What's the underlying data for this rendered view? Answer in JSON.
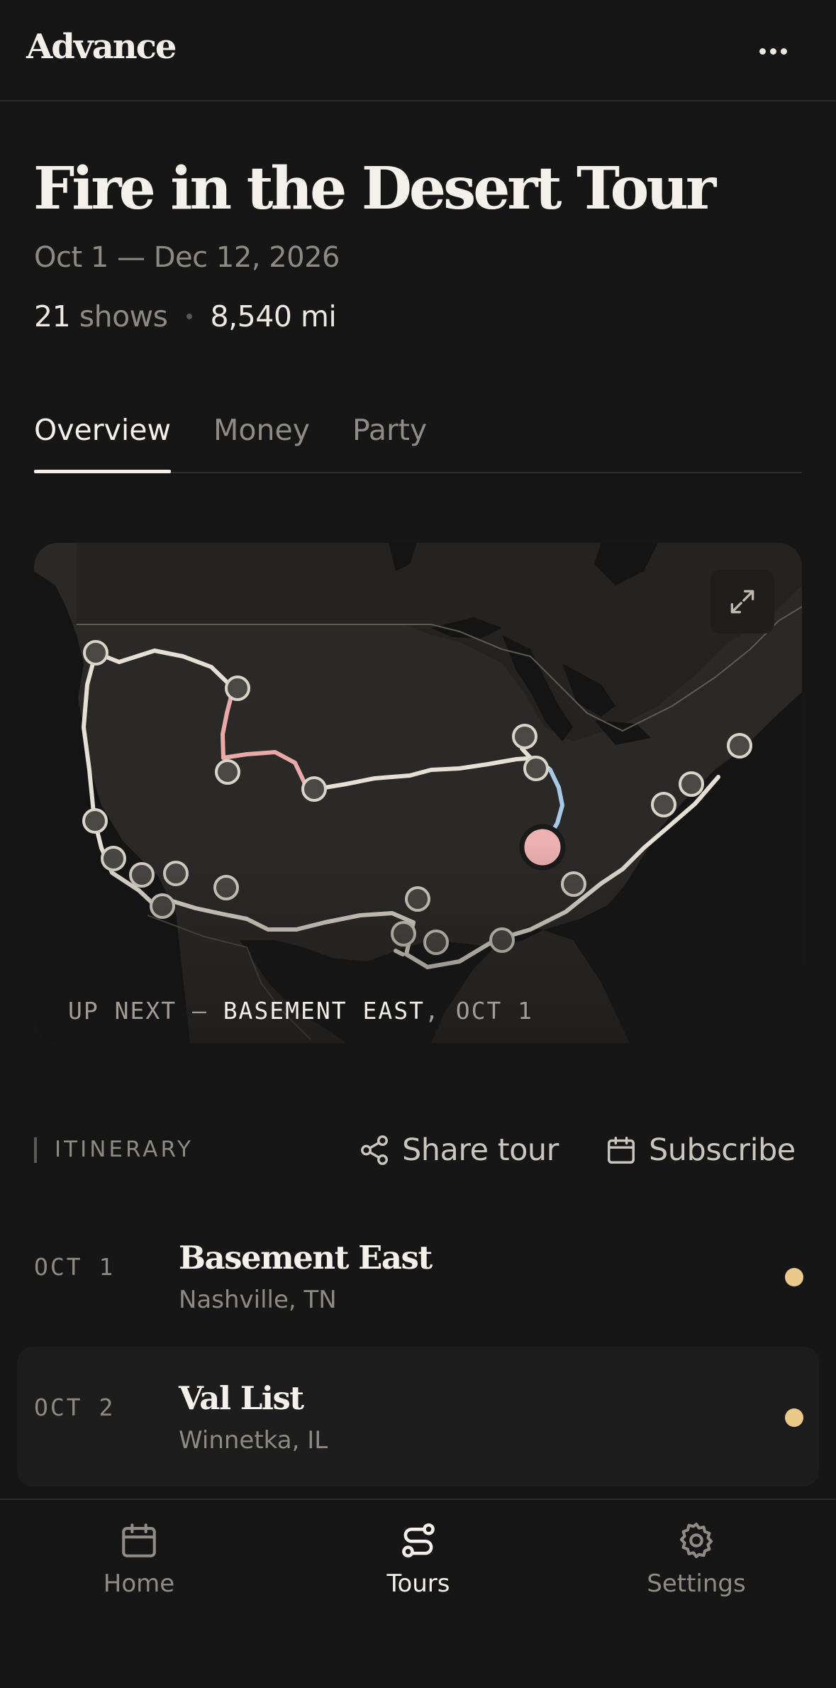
{
  "app": {
    "brand": "Advance"
  },
  "header": {
    "title": "Fire in the Desert Tour",
    "dates": "Oct 1 — Dec 12, 2026",
    "shows_count": "21",
    "shows_word": "shows",
    "distance": "8,540 mi"
  },
  "tabs": [
    {
      "label": "Overview",
      "active": true
    },
    {
      "label": "Money",
      "active": false
    },
    {
      "label": "Party",
      "active": false
    }
  ],
  "map": {
    "up_next_prefix": "UP NEXT — ",
    "up_next_venue": "BASEMENT EAST",
    "up_next_date": ", OCT 1",
    "route_colors": {
      "main": "#E5E0D6",
      "highlight_pink": "#E9A9A9",
      "highlight_blue": "#A9C8E6",
      "current_stop": "#EDB1B1"
    }
  },
  "itinerary": {
    "label": "ITINERARY",
    "share_label": "Share tour",
    "subscribe_label": "Subscribe",
    "rows": [
      {
        "date": "OCT 1",
        "venue": "Basement East",
        "city": "Nashville, TN",
        "status_color": "#EAC98A"
      },
      {
        "date": "OCT 2",
        "venue": "Val List",
        "city": "Winnetka, IL",
        "status_color": "#EAC98A"
      }
    ]
  },
  "nav": {
    "home": "Home",
    "tours": "Tours",
    "settings": "Settings",
    "active": "tours"
  },
  "icons": {
    "more": "more-horizontal-icon",
    "expand": "expand-icon",
    "share": "share-icon",
    "subscribe": "calendar-icon",
    "home": "calendar-icon",
    "tours": "route-icon",
    "settings": "gear-icon"
  }
}
